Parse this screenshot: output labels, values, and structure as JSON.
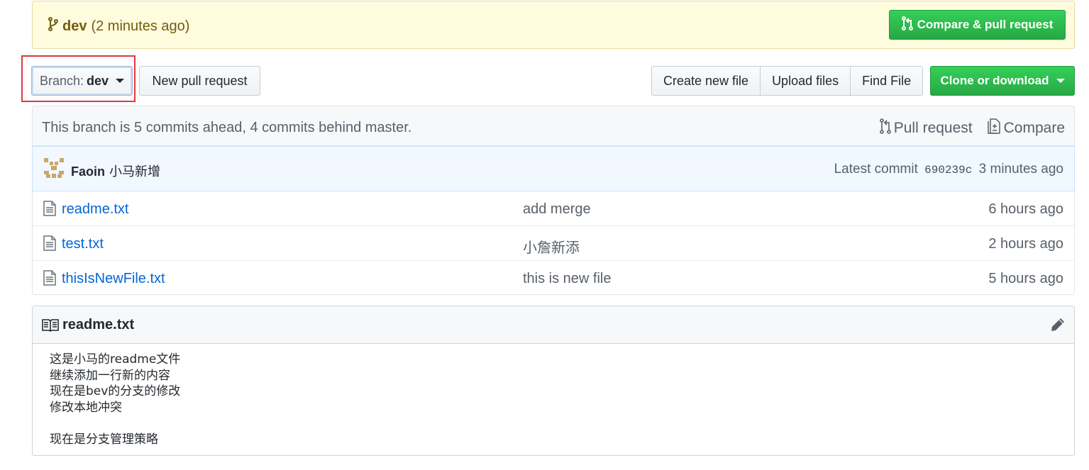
{
  "flash": {
    "branch": "dev",
    "time": "(2 minutes ago)",
    "compare_label": "Compare & pull request"
  },
  "toolbar": {
    "branch_prefix": "Branch:",
    "branch_name": "dev",
    "new_pr_label": "New pull request",
    "create_file_label": "Create new file",
    "upload_label": "Upload files",
    "find_label": "Find File",
    "clone_label": "Clone or download"
  },
  "branch_info": {
    "message": "This branch is 5 commits ahead, 4 commits behind master.",
    "pull_request_label": "Pull request",
    "compare_label": "Compare"
  },
  "commit": {
    "author": "Faoin",
    "message": "小马新增",
    "latest_prefix": "Latest commit",
    "sha": "690239c",
    "age": "3 minutes ago"
  },
  "files": [
    {
      "name": "readme.txt",
      "message": "add merge",
      "age": "6 hours ago"
    },
    {
      "name": "test.txt",
      "message": "小詹新添",
      "age": "2 hours ago"
    },
    {
      "name": "thisIsNewFile.txt",
      "message": "this is new file",
      "age": "5 hours ago"
    }
  ],
  "readme": {
    "title": "readme.txt",
    "lines": [
      "这是小马的readme文件",
      "继续添加一行新的内容",
      "现在是bev的分支的修改",
      "修改本地冲突",
      "",
      "现在是分支管理策略"
    ]
  },
  "colors": {
    "accent_green": "#28a745",
    "link_blue": "#0366d6",
    "flash_bg": "#fffbdd",
    "highlight_red": "#e0383e"
  }
}
